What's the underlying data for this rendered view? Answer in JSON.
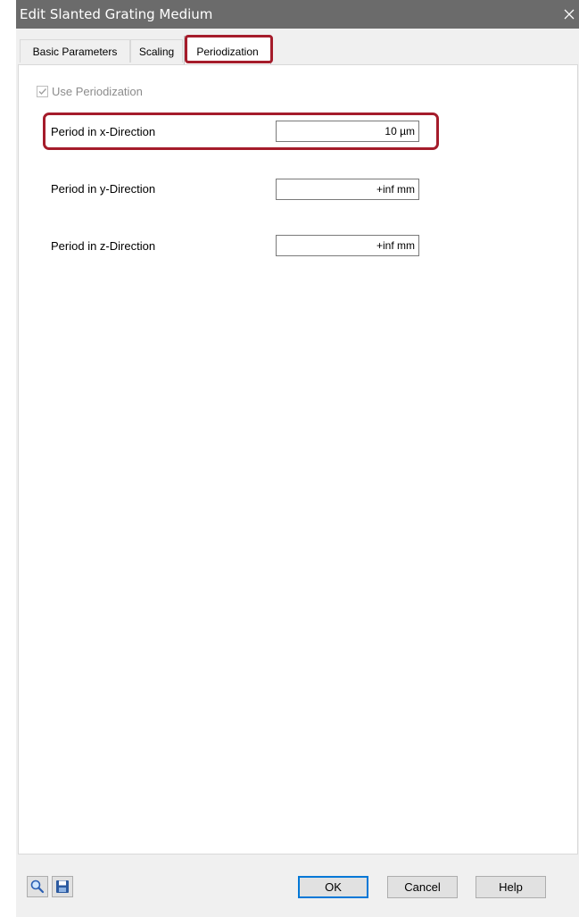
{
  "window": {
    "title": "Edit Slanted Grating Medium"
  },
  "tabs": [
    {
      "label": "Basic Parameters"
    },
    {
      "label": "Scaling"
    },
    {
      "label": "Periodization",
      "active": true
    }
  ],
  "periodization": {
    "use_label": "Use Periodization",
    "use_checked": true,
    "use_enabled": false,
    "params": [
      {
        "label": "Period in x-Direction",
        "value": "10 µm"
      },
      {
        "label": "Period in y-Direction",
        "value": "+inf mm"
      },
      {
        "label": "Period in z-Direction",
        "value": "+inf mm"
      }
    ]
  },
  "footer": {
    "search_icon": "magnifier-icon",
    "save_icon": "floppy-disk-icon",
    "ok_label": "OK",
    "cancel_label": "Cancel",
    "help_label": "Help"
  },
  "colors": {
    "titlebar": "#6b6b6b",
    "highlight": "#a51c2b",
    "default_button_border": "#0078d7"
  }
}
